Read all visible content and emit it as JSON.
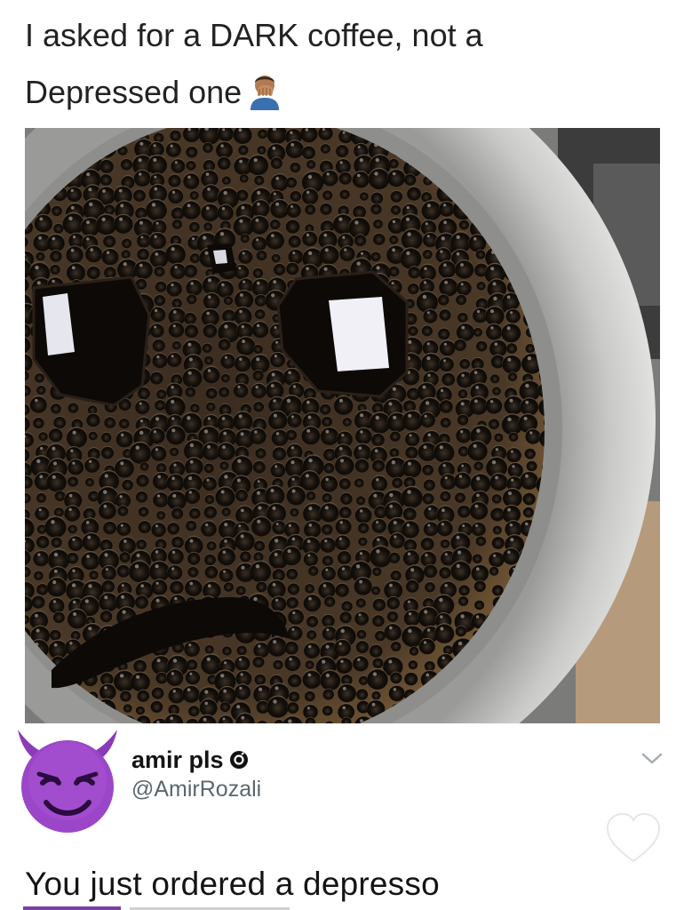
{
  "post": {
    "caption_line1": "I asked for a DARK coffee, not a",
    "caption_line2": "Depressed one",
    "caption_emoji": "man-facepalming-emoji"
  },
  "photo": {
    "subject": "coffee-cup-bubbles-face-icon"
  },
  "tweet": {
    "avatar": "smiling-devil-emoji",
    "display_name": "amir pls",
    "verified_icon": "verified-badge-icon",
    "handle": "@AmirRozali",
    "text": "You just ordered a depresso",
    "menu_icon": "chevron-down-icon",
    "like_icon": "heart-icon"
  },
  "colors": {
    "avatar_purple": "#9b46c8",
    "handle_gray": "#5b6670",
    "coffee_dark": "#1a120c",
    "foam_brown": "#6b4f2c"
  }
}
